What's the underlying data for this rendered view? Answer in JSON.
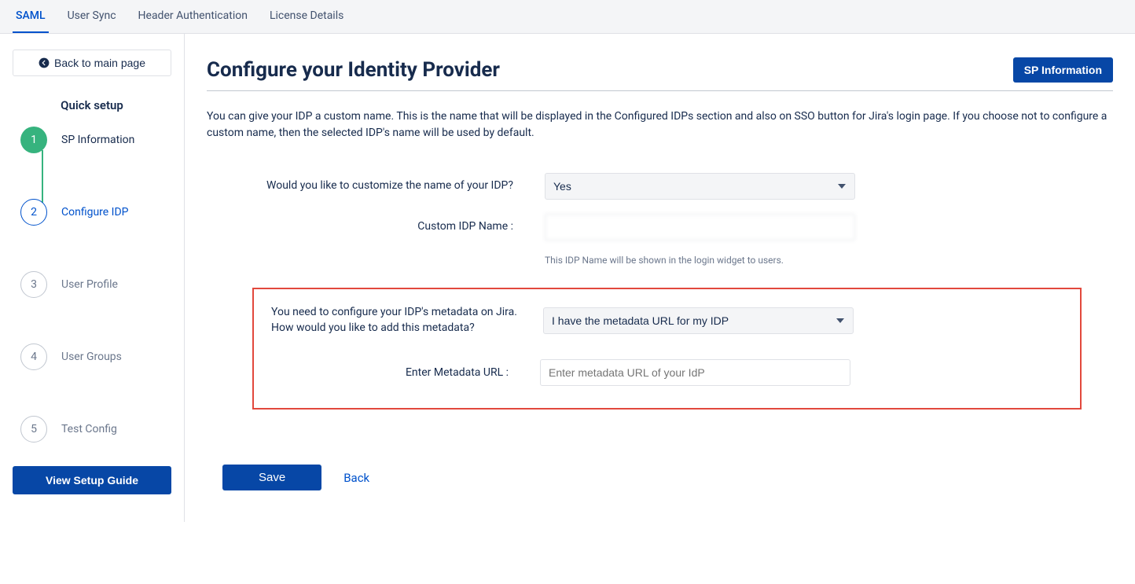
{
  "tabs": [
    "SAML",
    "User Sync",
    "Header Authentication",
    "License Details"
  ],
  "activeTab": "SAML",
  "sidebar": {
    "back": "Back to main page",
    "title": "Quick setup",
    "steps": [
      {
        "num": "1",
        "label": "SP Information",
        "state": "done"
      },
      {
        "num": "2",
        "label": "Configure IDP",
        "state": "active"
      },
      {
        "num": "3",
        "label": "User Profile",
        "state": "pending"
      },
      {
        "num": "4",
        "label": "User Groups",
        "state": "pending"
      },
      {
        "num": "5",
        "label": "Test Config",
        "state": "pending"
      }
    ],
    "guide": "View Setup Guide"
  },
  "main": {
    "title": "Configure your Identity Provider",
    "spButton": "SP Information",
    "desc": "You can give your IDP a custom name. This is the name that will be displayed in the Configured IDPs section and also on SSO button for Jira's login page. If you choose not to configure a custom name, then the selected IDP's name will be used by default.",
    "fields": {
      "customizeLabel": "Would you like to customize the name of your IDP?",
      "customizeValue": "Yes",
      "customNameLabel": "Custom IDP Name :",
      "customNameValue": "",
      "customNameHint": "This IDP Name will be shown in the login widget to users.",
      "metadataPrompt": "You need to configure your IDP's metadata on Jira. How would you like to add this metadata?",
      "metadataOption": "I have the metadata URL for my IDP",
      "metadataUrlLabel": "Enter Metadata URL :",
      "metadataUrlPlaceholder": "Enter metadata URL of your IdP"
    },
    "save": "Save",
    "back": "Back"
  }
}
